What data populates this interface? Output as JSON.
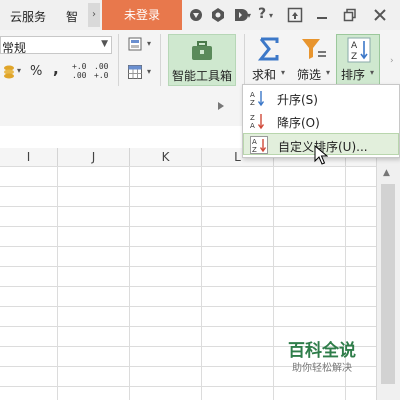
{
  "titlebar": {
    "tabs": [
      "云服务",
      "智"
    ],
    "more_glyph": "›",
    "login_label": "未登录",
    "icons": [
      "skin-icon",
      "settings-icon",
      "share-icon",
      "help-icon",
      "collapse-ribbon-icon",
      "minimize-icon",
      "restore-icon",
      "close-icon"
    ]
  },
  "ribbon": {
    "number_format": "常规",
    "percent": "%",
    "comma": ",",
    "decimal_increase": "+.0\n.00",
    "decimal_decrease": ".00\n+.0",
    "smart_toolbox_label": "智能工具箱",
    "sum_label": "求和",
    "filter_label": "筛选",
    "sort_label": "排序",
    "dropdown_arrow": "▾"
  },
  "columns": [
    "I",
    "J",
    "K",
    "L"
  ],
  "sort_menu": {
    "items": [
      {
        "label": "升序(S)",
        "highlighted": false
      },
      {
        "label": "降序(O)",
        "highlighted": false
      },
      {
        "label": "自定义排序(U)...",
        "highlighted": true
      }
    ]
  },
  "watermark": {
    "title": "百科全说",
    "subtitle": "助你轻松解决"
  },
  "colors": {
    "login_bg": "#e8784c",
    "highlight_green": "#cfe8cf",
    "menu_hover": "#e2efdc",
    "sum_blue": "#3c78c8",
    "filter_orange": "#e8952e",
    "watermark_green": "#2f7d4a"
  }
}
